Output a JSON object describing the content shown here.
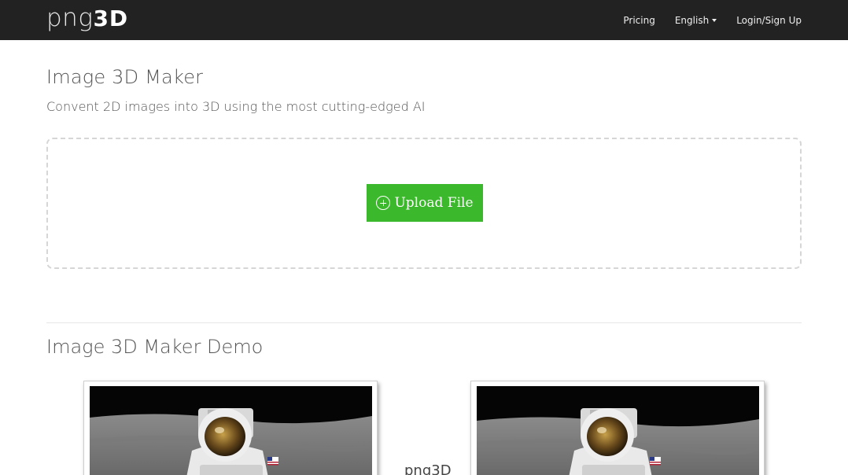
{
  "brand": {
    "light": "png",
    "bold": "3D"
  },
  "nav": {
    "pricing": "Pricing",
    "language": "English",
    "login": "Login/Sign Up"
  },
  "hero": {
    "title": "Image 3D Maker",
    "subtitle": "Convent 2D images into 3D using the most cutting-edged AI"
  },
  "upload": {
    "button_label": "Upload File",
    "icon": "plus-circle-icon",
    "button_color": "#3bb82b"
  },
  "demo": {
    "title": "Image 3D Maker Demo",
    "between_label": "png3D"
  },
  "colors": {
    "navbar": "#222222",
    "accent_green": "#3bb82b"
  }
}
